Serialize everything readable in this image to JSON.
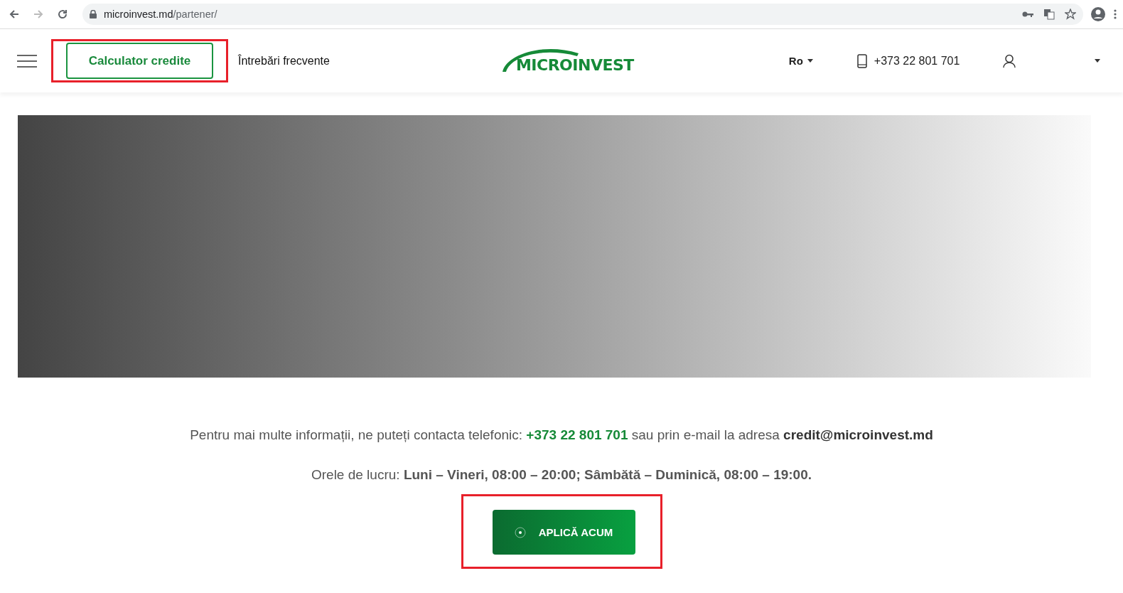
{
  "browser": {
    "url_host": "microinvest.md",
    "url_path": "/partener/"
  },
  "nav": {
    "calculator_button": "Calculator credite",
    "calculator_highlighted": true,
    "faq_link": "Întrebări frecvente",
    "logo_text": "MICROINVEST",
    "language": "Ro",
    "phone": "+373 22 801 701"
  },
  "hero": {
    "kind": "gradient"
  },
  "contact_text": "Pentru mai multe informații, ne puteți contacta telefonic: **+373 22 801 701** sau prin e-mail la adresa **credit@microinvest.md**",
  "hours_text": "Orele de lucru: **Luni – Vineri, 08:00 – 20:00; Sâmbătă – Duminică, 08:00 – 19:00.**",
  "apply_button": {
    "label": "APLICĂ ACUM",
    "highlighted": true
  }
}
